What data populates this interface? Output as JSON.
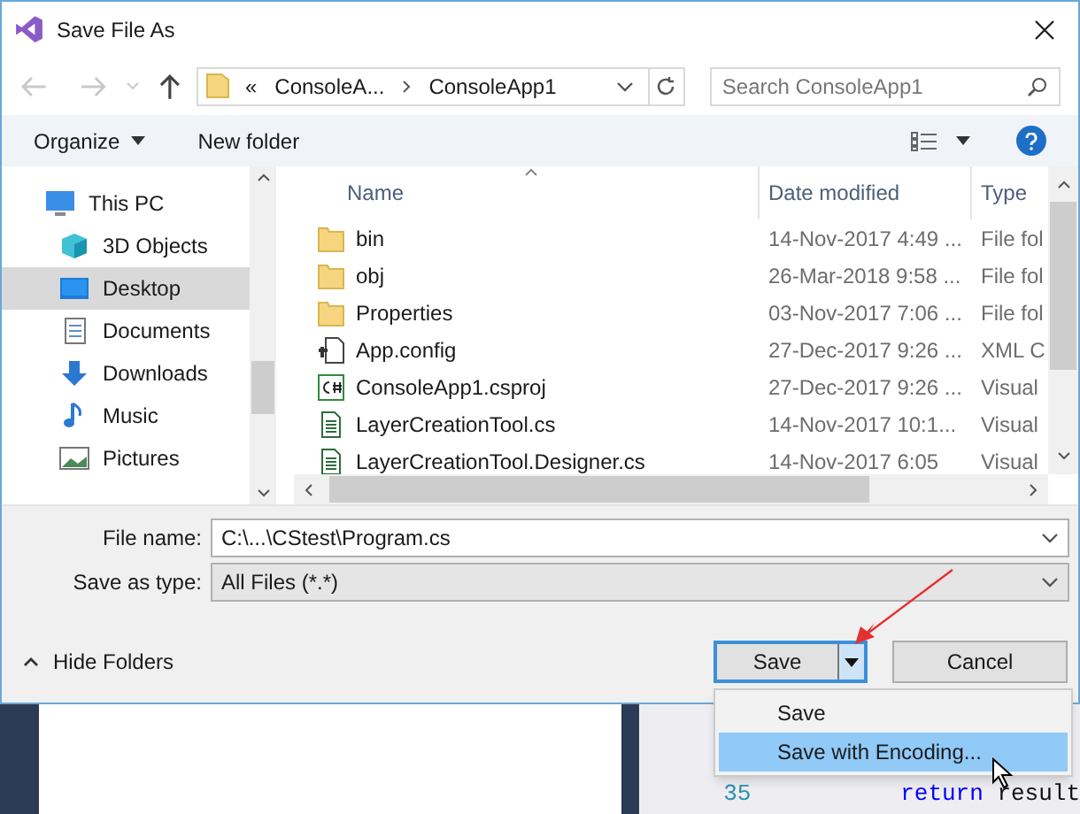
{
  "window": {
    "title": "Save File As"
  },
  "nav": {
    "chevrons": "«",
    "path": [
      "ConsoleA...",
      "ConsoleApp1"
    ],
    "search_placeholder": "Search ConsoleApp1"
  },
  "toolbar": {
    "organize": "Organize",
    "new_folder": "New folder"
  },
  "sidebar": {
    "items": [
      {
        "label": "This PC",
        "kind": "pc",
        "selected": false
      },
      {
        "label": "3D Objects",
        "kind": "cube",
        "selected": false
      },
      {
        "label": "Desktop",
        "kind": "desktop",
        "selected": true
      },
      {
        "label": "Documents",
        "kind": "docs",
        "selected": false
      },
      {
        "label": "Downloads",
        "kind": "download",
        "selected": false
      },
      {
        "label": "Music",
        "kind": "music",
        "selected": false
      },
      {
        "label": "Pictures",
        "kind": "pictures",
        "selected": false
      }
    ]
  },
  "table": {
    "columns": [
      "Name",
      "Date modified",
      "Type"
    ],
    "rows": [
      {
        "name": "bin",
        "date": "14-Nov-2017 4:49 ...",
        "type": "File fol",
        "kind": "folder"
      },
      {
        "name": "obj",
        "date": "26-Mar-2018 9:58 ...",
        "type": "File fol",
        "kind": "folder"
      },
      {
        "name": "Properties",
        "date": "03-Nov-2017 7:06 ...",
        "type": "File fol",
        "kind": "folder"
      },
      {
        "name": "App.config",
        "date": "27-Dec-2017 9:26 ...",
        "type": "XML C",
        "kind": "config"
      },
      {
        "name": "ConsoleApp1.csproj",
        "date": "27-Dec-2017 9:26 ...",
        "type": "Visual",
        "kind": "csharp"
      },
      {
        "name": "LayerCreationTool.cs",
        "date": "14-Nov-2017 10:1...",
        "type": "Visual",
        "kind": "code"
      },
      {
        "name": "LayerCreationTool.Designer.cs",
        "date": "14-Nov-2017 6:05",
        "type": "Visual",
        "kind": "code"
      }
    ]
  },
  "file_name": {
    "label": "File name:",
    "value": "C:\\...\\CStest\\Program.cs"
  },
  "save_as_type": {
    "label": "Save as type:",
    "value": "All Files (*.*)"
  },
  "hide_folders": "Hide Folders",
  "buttons": {
    "save": "Save",
    "cancel": "Cancel"
  },
  "save_menu": [
    {
      "label": "Save",
      "selected": false
    },
    {
      "label": "Save with Encoding...",
      "selected": true
    }
  ],
  "editor": {
    "line_number": "35",
    "tokens": [
      {
        "text": "return",
        "kind": "keyword"
      },
      {
        "text": "result",
        "kind": "plain"
      }
    ]
  }
}
